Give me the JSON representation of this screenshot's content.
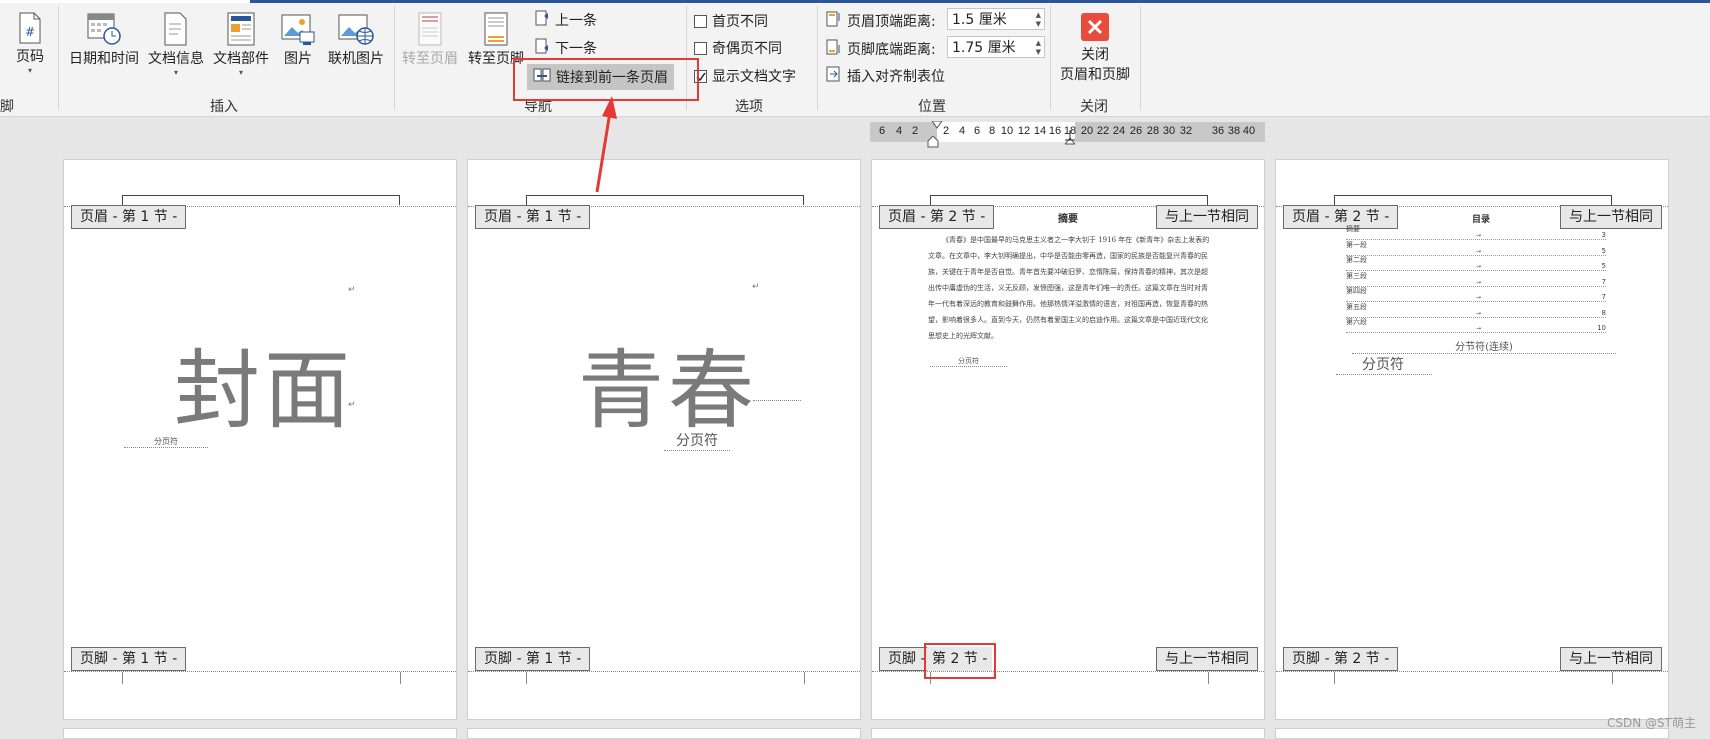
{
  "ribbon": {
    "page_num": "页码",
    "partial_group": "脚",
    "insert": {
      "group": "插入",
      "datetime": "日期和时间",
      "docinfo": "文档信息",
      "parts": "文档部件",
      "picture": "图片",
      "online_picture": "联机图片"
    },
    "nav": {
      "group": "导航",
      "goto_header": "转至页眉",
      "goto_footer": "转至页脚",
      "prev": "上一条",
      "next": "下一条",
      "link_prev": "链接到前一条页眉"
    },
    "options": {
      "group": "选项",
      "diff_first": "首页不同",
      "diff_odd_even": "奇偶页不同",
      "show_doc_text": "显示文档文字"
    },
    "position": {
      "group": "位置",
      "header_top_label": "页眉顶端距离:",
      "header_top_value": "1.5 厘米",
      "footer_bottom_label": "页脚底端距离:",
      "footer_bottom_value": "1.75 厘米",
      "insert_align_tab": "插入对齐制表位"
    },
    "close": {
      "group": "关闭",
      "label_line1": "关闭",
      "label_line2": "页眉和页脚"
    }
  },
  "ruler": {
    "numbers": [
      "6",
      "4",
      "2",
      "",
      "2",
      "4",
      "6",
      "8",
      "10",
      "12",
      "14",
      "16",
      "18",
      "20",
      "22",
      "24",
      "26",
      "28",
      "30",
      "32",
      "",
      "36",
      "38",
      "40"
    ]
  },
  "pages": [
    {
      "header_tag": "页眉 - 第 1 节 -",
      "footer_tag": "页脚 - 第 1 节 -",
      "big_text": "封面",
      "page_break": "分页符"
    },
    {
      "header_tag": "页眉 - 第 1 节 -",
      "footer_tag": "页脚 - 第 1 节 -",
      "big_text": "青春",
      "page_break": "分页符"
    },
    {
      "header_tag": "页眉 - 第 2 节 -",
      "footer_tag_a": "页脚 -",
      "footer_tag_b": "第 2 节 -",
      "same_as_prev": "与上一节相同",
      "title": "摘要",
      "abstract": "《青春》是中国最早的马克思主义者之一李大钊于 1916 年在《新青年》杂志上发表的文章。在文章中，李大钊明确提出，中华是否能由零再造，国家的民族是否能复兴青春的民族，关键在于青年是否自觉。青年首先要冲破旧罗、恋惰陈腐，保持青春的精神，其次是超出传中庸虚伪的生活，义无反顾，发愤图强，这是青年们唯一的责任。这篇文章在当时对青年一代有着深远的教育和鼓舞作用。他那热情洋溢激情的语言，对祖国再造，恢复青春的热望，影响着很多人。直到今天，仍然有着爱国主义的启迪作用。这篇文章是中国近现代文化思想史上的光辉文献。",
      "page_break": "分页符"
    },
    {
      "header_tag": "页眉 - 第 2 节 -",
      "footer_tag": "页脚 - 第 2 节 -",
      "same_as_prev": "与上一节相同",
      "title": "目录",
      "toc": [
        {
          "label": "摘要",
          "num": "3"
        },
        {
          "label": "第一段",
          "num": "5"
        },
        {
          "label": "第二段",
          "num": "5"
        },
        {
          "label": "第三段",
          "num": "7"
        },
        {
          "label": "第四段",
          "num": "7"
        },
        {
          "label": "第五段",
          "num": "8"
        },
        {
          "label": "第六段",
          "num": "10"
        }
      ],
      "section_break": "分节符(连续)",
      "page_break": "分页符"
    }
  ],
  "watermark": "CSDN @ST萌主",
  "colors": {
    "accent": "#2b579a",
    "highlight": "#e53935",
    "close_icon": "#e84c3d"
  }
}
